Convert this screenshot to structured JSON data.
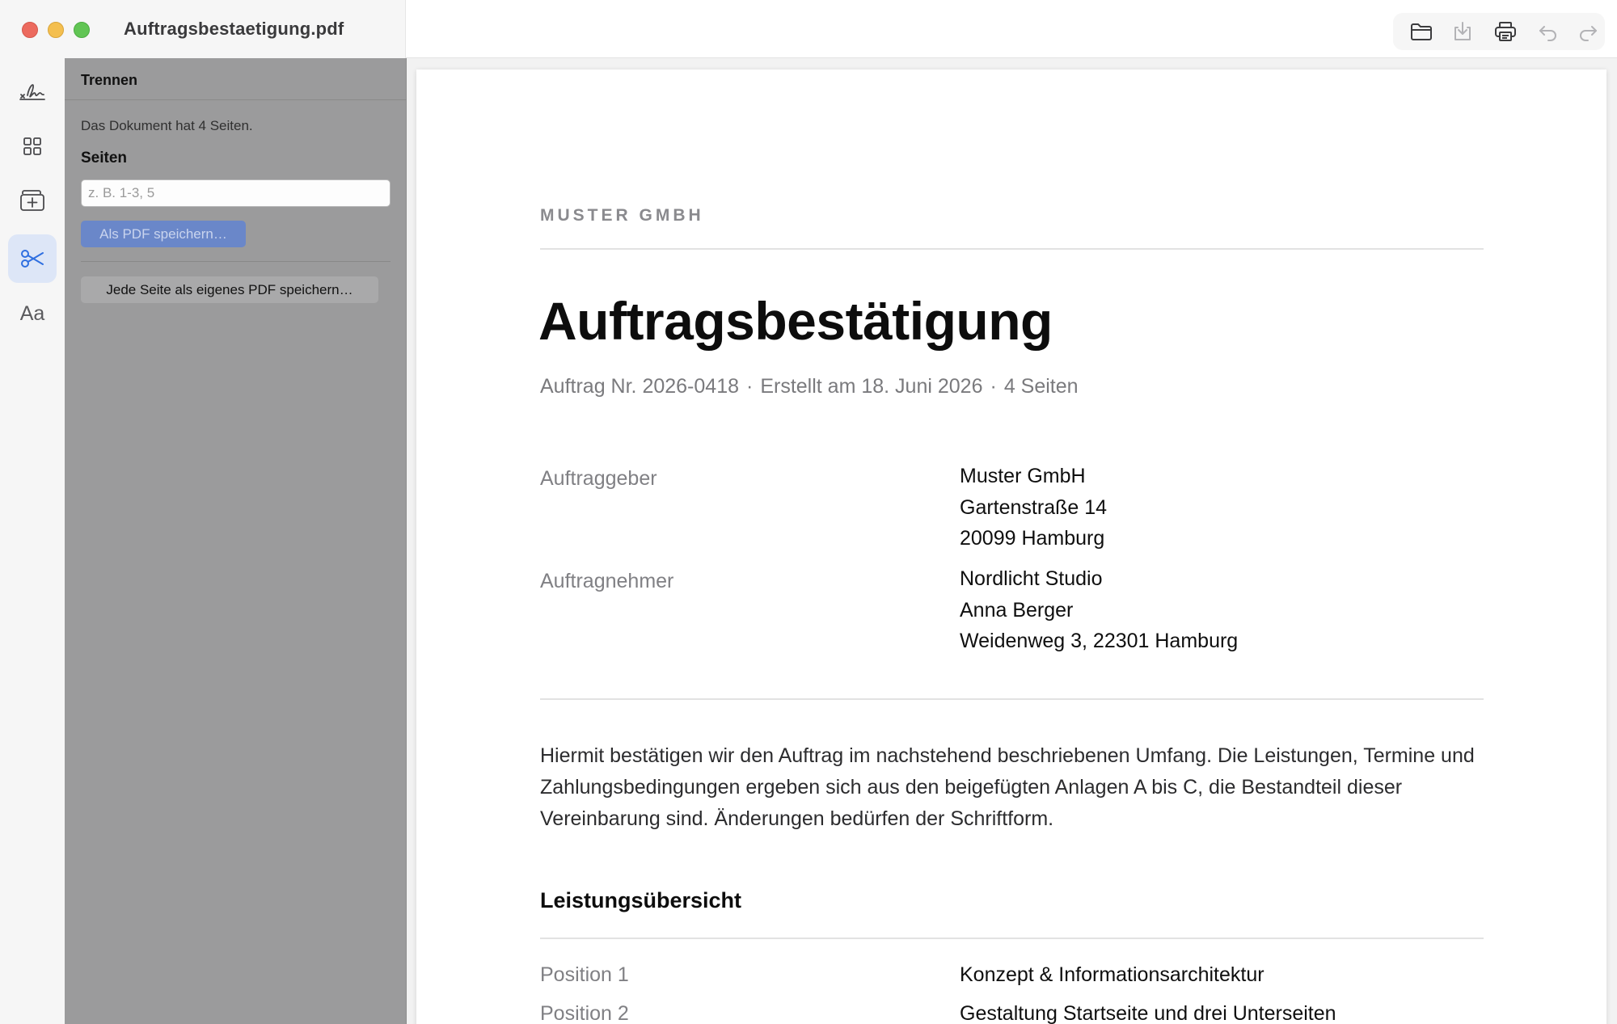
{
  "window": {
    "title": "Auftragsbestaetigung.pdf"
  },
  "toolbar": {
    "icons": [
      "folder-icon",
      "download-icon",
      "print-icon",
      "undo-icon",
      "redo-icon"
    ]
  },
  "rail": {
    "icons": [
      "signature-icon",
      "grid-icon",
      "add-page-icon",
      "scissors-icon",
      "text-format-icon"
    ],
    "text_format_label": "Aa",
    "active": "scissors-icon"
  },
  "split_panel": {
    "title": "Trennen",
    "info": "Das Dokument hat 4 Seiten.",
    "pages_label": "Seiten",
    "pages_value": "",
    "pages_placeholder": "z. B. 1-3, 5",
    "save_button": "Als PDF speichern…",
    "each_page_button": "Jede Seite als eigenes PDF speichern…"
  },
  "document": {
    "company": "MUSTER GMBH",
    "title": "Auftragsbestätigung",
    "meta": {
      "order": "Auftrag Nr. 2026-0418",
      "created": "Erstellt am 18. Juni 2026",
      "pages": "4 Seiten",
      "separator": "·"
    },
    "client": {
      "label": "Auftraggeber",
      "lines": [
        "Muster GmbH",
        "Gartenstraße 14",
        "20099 Hamburg"
      ]
    },
    "contractor": {
      "label": "Auftragnehmer",
      "lines": [
        "Nordlicht Studio",
        "Anna Berger",
        "Weidenweg 3, 22301 Hamburg"
      ]
    },
    "body": "Hiermit bestätigen wir den Auftrag im nachstehend beschriebenen Umfang. Die Leistungen, Termine und Zahlungsbedingungen ergeben sich aus den beigefügten Anlagen A bis C, die Bestandteil dieser Vereinbarung sind. Änderungen bedürfen der Schriftform.",
    "section_title": "Leistungsübersicht",
    "positions": [
      {
        "label": "Position 1",
        "value": "Konzept & Informationsarchitektur"
      },
      {
        "label": "Position 2",
        "value": "Gestaltung Startseite und drei Unterseiten"
      }
    ]
  },
  "colors": {
    "accent": "#2f6fe0",
    "panel_bg": "#9b9b9c",
    "save_button_bg": "#6a87c9"
  }
}
